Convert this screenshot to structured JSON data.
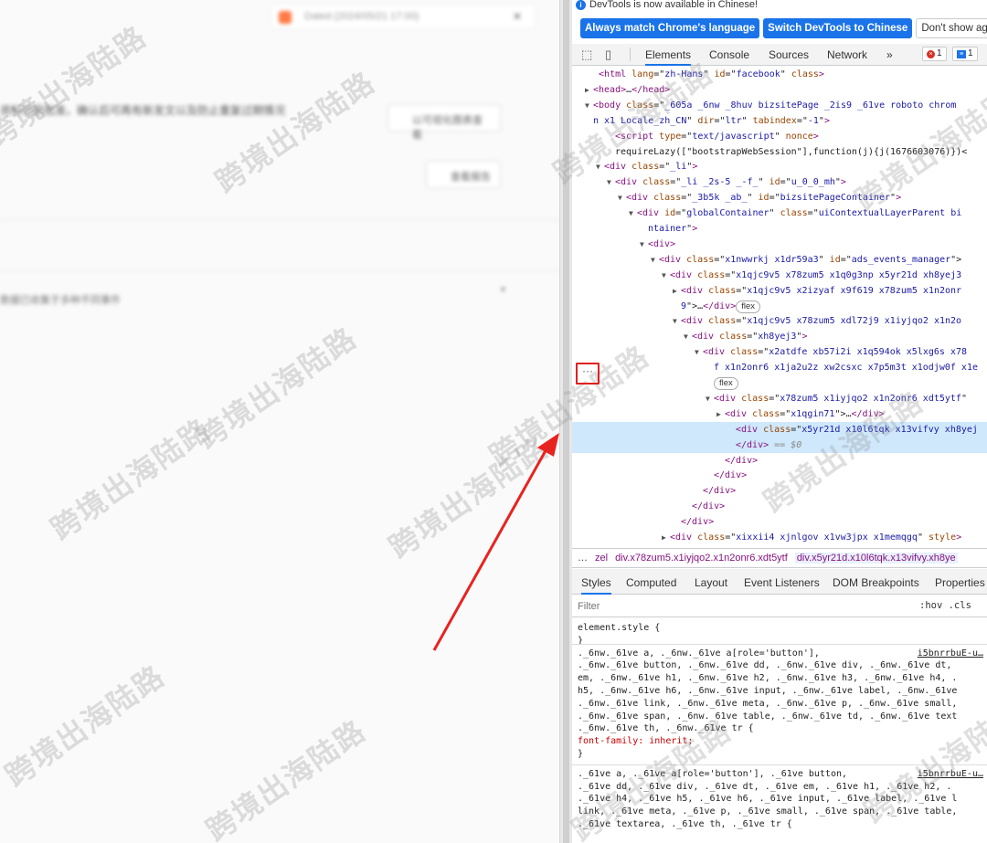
{
  "left_page": {
    "notice_text": "Dated (2024/05/21 17:00)",
    "notice_close": "✕",
    "description": "资料已获批准，确认后可再有新发文以及防止重复过期情况",
    "button1_label": "以可视化图表查看",
    "button2_label": "查看报告",
    "footer_text": "数据已收集于多种不同事件",
    "caret": "▾"
  },
  "watermark_text": "跨境出海陆路",
  "devtools": {
    "info_bar": "DevTools is now available in Chinese!",
    "info_buttons": [
      "Always match Chrome's language",
      "Switch DevTools to Chinese",
      "Don't show again"
    ],
    "tabs": [
      "Elements",
      "Console",
      "Sources",
      "Network",
      "»"
    ],
    "error_count": "1",
    "message_count": "1",
    "dom_lines": [
      {
        "indent": 0,
        "tri": "",
        "parts": [
          [
            "p",
            "  "
          ],
          [
            "t",
            "<html"
          ],
          [
            "a",
            " lang"
          ],
          [
            "p",
            "=\""
          ],
          [
            "v",
            "zh-Hans"
          ],
          [
            "p",
            "\""
          ],
          [
            "a",
            " id"
          ],
          [
            "p",
            "=\""
          ],
          [
            "v",
            "facebook"
          ],
          [
            "p",
            "\""
          ],
          [
            "a",
            " class"
          ],
          [
            "t",
            ">"
          ]
        ]
      },
      {
        "indent": 0,
        "tri": "▶",
        "parts": [
          [
            "t",
            "<head>"
          ],
          [
            "p",
            "…"
          ],
          [
            "t",
            "</head>"
          ]
        ]
      },
      {
        "indent": 0,
        "tri": "▼",
        "parts": [
          [
            "t",
            "<body"
          ],
          [
            "a",
            " class"
          ],
          [
            "p",
            "=\""
          ],
          [
            "v",
            "_605a _6nw _8huv bizsitePage _2is9 _61ve roboto chrom"
          ],
          [
            "p",
            ""
          ]
        ]
      },
      {
        "indent": 0,
        "tri": "",
        "parts": [
          [
            "v",
            "n x1 Locale_zh_CN"
          ],
          [
            "p",
            "\""
          ],
          [
            "a",
            " dir"
          ],
          [
            "p",
            "=\""
          ],
          [
            "v",
            "ltr"
          ],
          [
            "p",
            "\""
          ],
          [
            "a",
            " tabindex"
          ],
          [
            "p",
            "=\""
          ],
          [
            "v",
            "-1"
          ],
          [
            "p",
            "\""
          ],
          [
            "t",
            ">"
          ]
        ]
      },
      {
        "indent": 2,
        "tri": "",
        "parts": [
          [
            "t",
            "<script"
          ],
          [
            "a",
            " type"
          ],
          [
            "p",
            "=\""
          ],
          [
            "v",
            "text/javascript"
          ],
          [
            "p",
            "\""
          ],
          [
            "a",
            " nonce"
          ],
          [
            "t",
            ">"
          ]
        ]
      },
      {
        "indent": 2,
        "tri": "",
        "parts": [
          [
            "p",
            "requireLazy([\"bootstrapWebSession\"],function(j){j(1676603076)})<"
          ]
        ]
      },
      {
        "indent": 1,
        "tri": "▼",
        "parts": [
          [
            "t",
            "<div"
          ],
          [
            "a",
            " class"
          ],
          [
            "p",
            "=\""
          ],
          [
            "v",
            "_li"
          ],
          [
            "p",
            "\""
          ],
          [
            "t",
            ">"
          ]
        ]
      },
      {
        "indent": 2,
        "tri": "▼",
        "parts": [
          [
            "t",
            "<div"
          ],
          [
            "a",
            " class"
          ],
          [
            "p",
            "=\""
          ],
          [
            "v",
            "_li _2s-5 _-f_"
          ],
          [
            "p",
            "\""
          ],
          [
            "a",
            " id"
          ],
          [
            "p",
            "=\""
          ],
          [
            "v",
            "u_0_0_mh"
          ],
          [
            "p",
            "\""
          ],
          [
            "t",
            ">"
          ]
        ]
      },
      {
        "indent": 3,
        "tri": "▼",
        "parts": [
          [
            "t",
            "<div"
          ],
          [
            "a",
            " class"
          ],
          [
            "p",
            "=\""
          ],
          [
            "v",
            "_3b5k _ab_"
          ],
          [
            "p",
            "\""
          ],
          [
            "a",
            " id"
          ],
          [
            "p",
            "=\""
          ],
          [
            "v",
            "bizsitePageContainer"
          ],
          [
            "p",
            "\""
          ],
          [
            "t",
            ">"
          ]
        ]
      },
      {
        "indent": 4,
        "tri": "▼",
        "parts": [
          [
            "t",
            "<div"
          ],
          [
            "a",
            " id"
          ],
          [
            "p",
            "=\""
          ],
          [
            "v",
            "globalContainer"
          ],
          [
            "p",
            "\""
          ],
          [
            "a",
            " class"
          ],
          [
            "p",
            "=\""
          ],
          [
            "v",
            "uiContextualLayerParent bi"
          ]
        ]
      },
      {
        "indent": 5,
        "tri": "",
        "parts": [
          [
            "v",
            "ntainer"
          ],
          [
            "p",
            "\""
          ],
          [
            "t",
            ">"
          ]
        ]
      },
      {
        "indent": 5,
        "tri": "▼",
        "parts": [
          [
            "t",
            "<div>"
          ]
        ]
      },
      {
        "indent": 6,
        "tri": "▼",
        "parts": [
          [
            "t",
            "<div"
          ],
          [
            "a",
            " class"
          ],
          [
            "p",
            "=\""
          ],
          [
            "v",
            "x1nwwrkj x1dr59a3"
          ],
          [
            "p",
            "\""
          ],
          [
            "a",
            " id"
          ],
          [
            "p",
            "=\""
          ],
          [
            "v",
            "ads_events_manager"
          ],
          [
            "p",
            "\">"
          ]
        ]
      },
      {
        "indent": 7,
        "tri": "▼",
        "parts": [
          [
            "t",
            "<div"
          ],
          [
            "a",
            " class"
          ],
          [
            "p",
            "=\""
          ],
          [
            "v",
            "x1qjc9v5 x78zum5 x1q0g3np x5yr21d xh8yej3"
          ]
        ]
      },
      {
        "indent": 8,
        "tri": "▶",
        "parts": [
          [
            "t",
            "<div"
          ],
          [
            "a",
            " class"
          ],
          [
            "p",
            "=\""
          ],
          [
            "v",
            "x1qjc9v5 x2izyaf x9f619 x78zum5 x1n2onr"
          ]
        ]
      },
      {
        "indent": 8,
        "tri": "",
        "parts": [
          [
            "v",
            "9"
          ],
          [
            "p",
            "\">…"
          ],
          [
            "t",
            "</div>"
          ],
          [
            "f",
            "flex"
          ]
        ]
      },
      {
        "indent": 8,
        "tri": "▼",
        "parts": [
          [
            "t",
            "<div"
          ],
          [
            "a",
            " class"
          ],
          [
            "p",
            "=\""
          ],
          [
            "v",
            "x1qjc9v5 x78zum5 xdl72j9 x1iyjqo2 x1n2o"
          ]
        ]
      },
      {
        "indent": 9,
        "tri": "▼",
        "parts": [
          [
            "t",
            "<div"
          ],
          [
            "a",
            " class"
          ],
          [
            "p",
            "=\""
          ],
          [
            "v",
            "xh8yej3"
          ],
          [
            "p",
            "\""
          ],
          [
            "t",
            ">"
          ]
        ]
      },
      {
        "indent": 10,
        "tri": "▼",
        "parts": [
          [
            "t",
            "<div"
          ],
          [
            "a",
            " class"
          ],
          [
            "p",
            "=\""
          ],
          [
            "v",
            "x2atdfe xb57i2i x1q594ok x5lxg6s x78"
          ]
        ]
      },
      {
        "indent": 11,
        "tri": "",
        "parts": [
          [
            "v",
            "f x1n2onr6 x1ja2u2z xw2csxc x7p5m3t x1odjw0f x1e"
          ]
        ]
      },
      {
        "indent": 11,
        "tri": "",
        "parts": [
          [
            "f",
            "flex"
          ]
        ]
      },
      {
        "indent": 11,
        "tri": "▼",
        "parts": [
          [
            "t",
            "<div"
          ],
          [
            "a",
            " class"
          ],
          [
            "p",
            "=\""
          ],
          [
            "v",
            "x78zum5 x1iyjqo2 x1n2onr6 xdt5ytf"
          ],
          [
            "p",
            "\""
          ]
        ]
      },
      {
        "indent": 12,
        "tri": "▶",
        "parts": [
          [
            "t",
            "<div"
          ],
          [
            "a",
            " class"
          ],
          [
            "p",
            "=\""
          ],
          [
            "v",
            "x1qgin71"
          ],
          [
            "p",
            "\">…"
          ],
          [
            "t",
            "</div>"
          ]
        ]
      },
      {
        "indent": 13,
        "tri": "",
        "sel": true,
        "parts": [
          [
            "t",
            "<div"
          ],
          [
            "a",
            " class"
          ],
          [
            "p",
            "=\""
          ],
          [
            "v",
            "x5yr21d x10l6tqk x13vifvy xh8yej"
          ]
        ]
      },
      {
        "indent": 13,
        "tri": "",
        "sel": true,
        "parts": [
          [
            "t",
            "</div>"
          ],
          [
            "e",
            " == $0"
          ]
        ]
      },
      {
        "indent": 12,
        "tri": "",
        "parts": [
          [
            "t",
            "</div>"
          ]
        ]
      },
      {
        "indent": 11,
        "tri": "",
        "parts": [
          [
            "t",
            "</div>"
          ]
        ]
      },
      {
        "indent": 10,
        "tri": "",
        "parts": [
          [
            "t",
            "</div>"
          ]
        ]
      },
      {
        "indent": 9,
        "tri": "",
        "parts": [
          [
            "t",
            "</div>"
          ]
        ]
      },
      {
        "indent": 8,
        "tri": "",
        "parts": [
          [
            "t",
            "</div>"
          ]
        ]
      },
      {
        "indent": 7,
        "tri": "▶",
        "parts": [
          [
            "t",
            "<div"
          ],
          [
            "a",
            " class"
          ],
          [
            "p",
            "=\""
          ],
          [
            "v",
            "xixxii4 xjnlgov x1vw3jpx x1memqgq"
          ],
          [
            "p",
            "\""
          ],
          [
            "a",
            " style"
          ],
          [
            "t",
            ">"
          ]
        ]
      }
    ],
    "ellipsis": "···",
    "breadcrumbs": [
      "…",
      "zel",
      "div.x78zum5.x1iyjqo2.x1n2onr6.xdt5ytf",
      "div.x5yr21d.x10l6tqk.x13vifvy.xh8ye"
    ],
    "styles_tabs": [
      "Styles",
      "Computed",
      "Layout",
      "Event Listeners",
      "DOM Breakpoints",
      "Properties"
    ],
    "filter_placeholder": "Filter",
    "filter_toggles": ":hov  .cls",
    "css_rules": [
      {
        "text": "element.style {",
        "kind": "p"
      },
      {
        "text": "}",
        "kind": "p"
      },
      {
        "text": "._6nw._61ve a, ._6nw._61ve a[role='button'],",
        "kind": "p",
        "src": "i5bnrrbuE-u…"
      },
      {
        "text": "._6nw._61ve button, ._6nw._61ve dd, ._6nw._61ve div, ._6nw._61ve dt,",
        "kind": "p"
      },
      {
        "text": "em, ._6nw._61ve h1, ._6nw._61ve h2, ._6nw._61ve h3, ._6nw._61ve h4, .",
        "kind": "p"
      },
      {
        "text": "h5, ._6nw._61ve h6, ._6nw._61ve input, ._6nw._61ve label, ._6nw._61ve",
        "kind": "p"
      },
      {
        "text": "._6nw._61ve link, ._6nw._61ve meta, ._6nw._61ve p, ._6nw._61ve small,",
        "kind": "p"
      },
      {
        "text": "._6nw._61ve span, ._6nw._61ve table, ._6nw._61ve td, ._6nw._61ve text",
        "kind": "p"
      },
      {
        "text": "._6nw._61ve th, ._6nw._61ve tr {",
        "kind": "p"
      },
      {
        "text": "  font-family: inherit;",
        "kind": "prop"
      },
      {
        "text": "}",
        "kind": "p"
      },
      {
        "text": "._61ve a, ._61ve a[role='button'], ._61ve button,",
        "kind": "p",
        "src": "i5bnrrbuE-u…"
      },
      {
        "text": "._61ve dd, ._61ve div, ._61ve dt, ._61ve em, ._61ve h1, ._61ve h2, .",
        "kind": "p"
      },
      {
        "text": "._61ve h4, ._61ve h5, ._61ve h6, ._61ve input, ._61ve label, ._61ve l",
        "kind": "p"
      },
      {
        "text": "link, ._61ve meta, ._61ve p, ._61ve small, ._61ve span, ._61ve table,",
        "kind": "p"
      },
      {
        "text": "._61ve textarea, ._61ve th, ._61ve tr {",
        "kind": "p"
      }
    ]
  }
}
